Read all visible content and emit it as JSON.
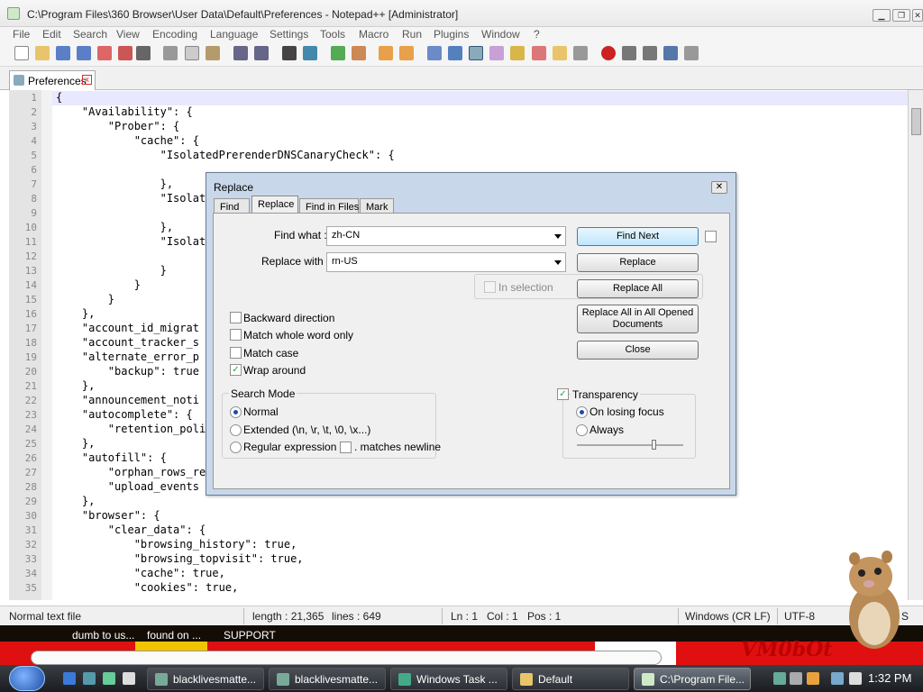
{
  "window": {
    "title": "C:\\Program Files\\360 Browser\\User Data\\Default\\Preferences - Notepad++ [Administrator]"
  },
  "menu": [
    "File",
    "Edit",
    "Search",
    "View",
    "Encoding",
    "Language",
    "Settings",
    "Tools",
    "Macro",
    "Run",
    "Plugins",
    "Window",
    "?"
  ],
  "tab": {
    "label": "Preferences"
  },
  "editor": {
    "lines": [
      {
        "n": "1",
        "t": "{"
      },
      {
        "n": "2",
        "t": "    \"Availability\": {"
      },
      {
        "n": "3",
        "t": "        \"Prober\": {"
      },
      {
        "n": "4",
        "t": "            \"cache\": {"
      },
      {
        "n": "5",
        "t": "                \"IsolatedPrerenderDNSCanaryCheck\": {"
      },
      {
        "n": "6",
        "t": ""
      },
      {
        "n": "7",
        "t": "                },"
      },
      {
        "n": "8",
        "t": "                \"Isolated"
      },
      {
        "n": "9",
        "t": ""
      },
      {
        "n": "10",
        "t": "                },"
      },
      {
        "n": "11",
        "t": "                \"Isolated"
      },
      {
        "n": "12",
        "t": ""
      },
      {
        "n": "13",
        "t": "                }"
      },
      {
        "n": "14",
        "t": "            }"
      },
      {
        "n": "15",
        "t": "        }"
      },
      {
        "n": "16",
        "t": "    },"
      },
      {
        "n": "17",
        "t": "    \"account_id_migrat"
      },
      {
        "n": "18",
        "t": "    \"account_tracker_s"
      },
      {
        "n": "19",
        "t": "    \"alternate_error_p"
      },
      {
        "n": "20",
        "t": "        \"backup\": true"
      },
      {
        "n": "21",
        "t": "    },"
      },
      {
        "n": "22",
        "t": "    \"announcement_noti"
      },
      {
        "n": "23",
        "t": "    \"autocomplete\": {"
      },
      {
        "n": "24",
        "t": "        \"retention_poli"
      },
      {
        "n": "25",
        "t": "    },"
      },
      {
        "n": "26",
        "t": "    \"autofill\": {"
      },
      {
        "n": "27",
        "t": "        \"orphan_rows_re"
      },
      {
        "n": "28",
        "t": "        \"upload_events"
      },
      {
        "n": "29",
        "t": "    },"
      },
      {
        "n": "30",
        "t": "    \"browser\": {"
      },
      {
        "n": "31",
        "t": "        \"clear_data\": {"
      },
      {
        "n": "32",
        "t": "            \"browsing_history\": true,"
      },
      {
        "n": "33",
        "t": "            \"browsing_topvisit\": true,"
      },
      {
        "n": "34",
        "t": "            \"cache\": true,"
      },
      {
        "n": "35",
        "t": "            \"cookies\": true,"
      }
    ]
  },
  "status": {
    "type": "Normal text file",
    "length": "length : 21,365",
    "lines": "lines : 649",
    "ln": "Ln : 1",
    "col": "Col : 1",
    "pos": "Pos : 1",
    "eol": "Windows (CR LF)",
    "encoding": "UTF-8",
    "ins": "S"
  },
  "dialog": {
    "title": "Replace",
    "close": "✕",
    "tabs": [
      "Find",
      "Replace",
      "Find in Files",
      "Mark"
    ],
    "find_label": "Find what :",
    "find_value": "zh-CN",
    "replace_label": "Replace with :",
    "replace_value": "rn-US",
    "in_selection": "In selection",
    "buttons": {
      "find_next": "Find Next",
      "replace": "Replace",
      "replace_all": "Replace All",
      "replace_all_opened": "Replace All in All Opened Documents",
      "close": "Close"
    },
    "options": {
      "backward": "Backward direction",
      "whole_word": "Match whole word only",
      "match_case": "Match case",
      "wrap_around": "Wrap around"
    },
    "search_mode": {
      "title": "Search Mode",
      "normal": "Normal",
      "extended": "Extended (\\n, \\r, \\t, \\0, \\x...)",
      "regex": "Regular expression",
      "matches_newline": ". matches newline"
    },
    "transparency": {
      "title": "Transparency",
      "on_losing_focus": "On losing focus",
      "always": "Always",
      "level": 0.72
    }
  },
  "banner": {
    "t1": "dumb to us...",
    "t2": "found on ...",
    "t3": "SUPPORT",
    "brand": "VM0bOt"
  },
  "taskbar": {
    "tasks": [
      "blacklivesmatte...",
      "blacklivesmatte...",
      "Windows Task ...",
      "Default",
      "C:\\Program File..."
    ],
    "clock": "1:32 PM"
  }
}
